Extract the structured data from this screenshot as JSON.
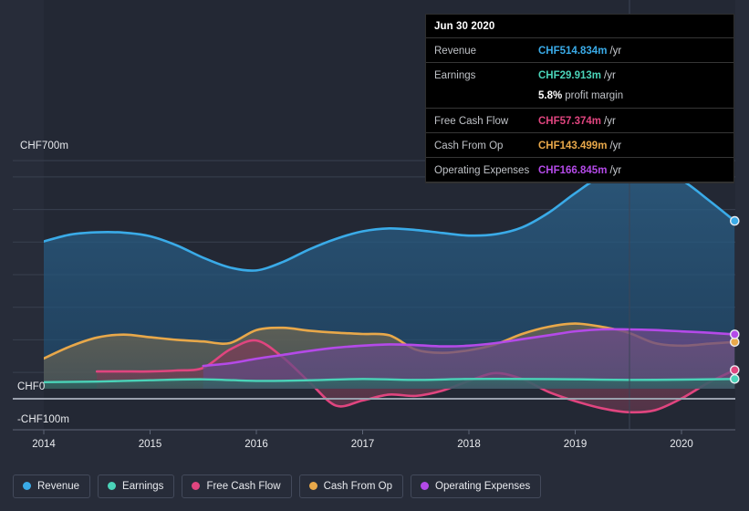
{
  "tooltip": {
    "date": "Jun 30 2020",
    "rows": [
      {
        "name": "Revenue",
        "value": "CHF514.834m",
        "unit": "/yr",
        "color": "#3aabe8"
      },
      {
        "name": "Earnings",
        "value": "CHF29.913m",
        "unit": "/yr",
        "color": "#4ad3b8"
      },
      {
        "name": "Free Cash Flow",
        "value": "CHF57.374m",
        "unit": "/yr",
        "color": "#e0457f"
      },
      {
        "name": "Cash From Op",
        "value": "CHF143.499m",
        "unit": "/yr",
        "color": "#e8a84a"
      },
      {
        "name": "Operating Expenses",
        "value": "CHF166.845m",
        "unit": "/yr",
        "color": "#b44ae8"
      }
    ],
    "margin_value": "5.8%",
    "margin_label": "profit margin"
  },
  "legend": {
    "items": [
      {
        "label": "Revenue",
        "color": "#3aabe8"
      },
      {
        "label": "Earnings",
        "color": "#4ad3b8"
      },
      {
        "label": "Free Cash Flow",
        "color": "#e0457f"
      },
      {
        "label": "Cash From Op",
        "color": "#e8a84a"
      },
      {
        "label": "Operating Expenses",
        "color": "#b44ae8"
      }
    ]
  },
  "chart_data": {
    "type": "area",
    "title": "",
    "xlabel": "",
    "ylabel": "CHF",
    "currency": "CHF",
    "grid": true,
    "legend_position": "bottom",
    "y_axis": {
      "labels": [
        "CHF700m",
        "CHF0",
        "-CHF100m"
      ],
      "values": [
        700,
        0,
        -100
      ],
      "ylim": [
        -100,
        720
      ],
      "gridline_values": [
        700,
        650,
        550,
        450,
        350,
        250,
        150,
        50
      ]
    },
    "x_axis": {
      "tick_labels": [
        "2014",
        "2015",
        "2016",
        "2017",
        "2018",
        "2019",
        "2020"
      ],
      "tick_values": [
        2014,
        2015,
        2016,
        2017,
        2018,
        2019,
        2020
      ],
      "xlim": [
        2013.85,
        2020.5
      ]
    },
    "series": [
      {
        "name": "Revenue",
        "color": "#3aabe8",
        "x": [
          2014.0,
          2014.25,
          2014.5,
          2014.75,
          2015.0,
          2015.25,
          2015.5,
          2015.75,
          2016.0,
          2016.25,
          2016.5,
          2016.75,
          2017.0,
          2017.25,
          2017.5,
          2017.75,
          2018.0,
          2018.25,
          2018.5,
          2018.75,
          2019.0,
          2019.25,
          2019.5,
          2019.75,
          2020.0,
          2020.25,
          2020.5
        ],
        "values": [
          452,
          473,
          480,
          479,
          468,
          440,
          402,
          372,
          363,
          389,
          428,
          460,
          483,
          492,
          487,
          478,
          470,
          474,
          495,
          540,
          600,
          652,
          663,
          663,
          640,
          580,
          514.834
        ]
      },
      {
        "name": "Earnings",
        "color": "#4ad3b8",
        "x": [
          2014.0,
          2014.5,
          2015.0,
          2015.5,
          2016.0,
          2016.5,
          2017.0,
          2017.5,
          2018.0,
          2018.5,
          2019.0,
          2019.5,
          2020.0,
          2020.5
        ],
        "values": [
          20,
          22,
          26,
          29,
          24,
          26,
          30,
          27,
          30,
          30,
          29,
          27,
          28,
          29.913
        ]
      },
      {
        "name": "Free Cash Flow",
        "color": "#e0457f",
        "x": [
          2014.5,
          2014.75,
          2015.0,
          2015.25,
          2015.5,
          2015.75,
          2016.0,
          2016.25,
          2016.5,
          2016.75,
          2017.0,
          2017.25,
          2017.5,
          2017.75,
          2018.0,
          2018.25,
          2018.5,
          2018.75,
          2019.0,
          2019.25,
          2019.5,
          2019.75,
          2020.0,
          2020.25,
          2020.5
        ],
        "values": [
          53,
          53,
          53,
          56,
          64,
          120,
          148,
          96,
          20,
          -52,
          -36,
          -18,
          -22,
          -6,
          24,
          48,
          30,
          -10,
          -38,
          -60,
          -72,
          -66,
          -30,
          18,
          57.374
        ]
      },
      {
        "name": "Cash From Op",
        "color": "#e8a84a",
        "x": [
          2014.0,
          2014.25,
          2014.5,
          2014.75,
          2015.0,
          2015.25,
          2015.5,
          2015.75,
          2016.0,
          2016.25,
          2016.5,
          2016.75,
          2017.0,
          2017.25,
          2017.5,
          2017.75,
          2018.0,
          2018.25,
          2018.5,
          2018.75,
          2019.0,
          2019.25,
          2019.5,
          2019.75,
          2020.0,
          2020.25,
          2020.5
        ],
        "values": [
          93,
          130,
          157,
          166,
          158,
          150,
          145,
          140,
          180,
          187,
          178,
          172,
          168,
          164,
          120,
          110,
          118,
          136,
          168,
          190,
          200,
          190,
          172,
          140,
          132,
          138,
          143.499
        ]
      },
      {
        "name": "Operating Expenses",
        "color": "#b44ae8",
        "x": [
          2015.5,
          2015.75,
          2016.0,
          2016.25,
          2016.5,
          2016.75,
          2017.0,
          2017.25,
          2017.5,
          2017.75,
          2018.0,
          2018.25,
          2018.5,
          2018.75,
          2019.0,
          2019.25,
          2019.5,
          2019.75,
          2020.0,
          2020.25,
          2020.5
        ],
        "values": [
          70,
          78,
          92,
          104,
          116,
          126,
          132,
          136,
          134,
          130,
          132,
          140,
          152,
          164,
          176,
          182,
          182,
          180,
          176,
          172,
          166.845
        ]
      }
    ]
  }
}
